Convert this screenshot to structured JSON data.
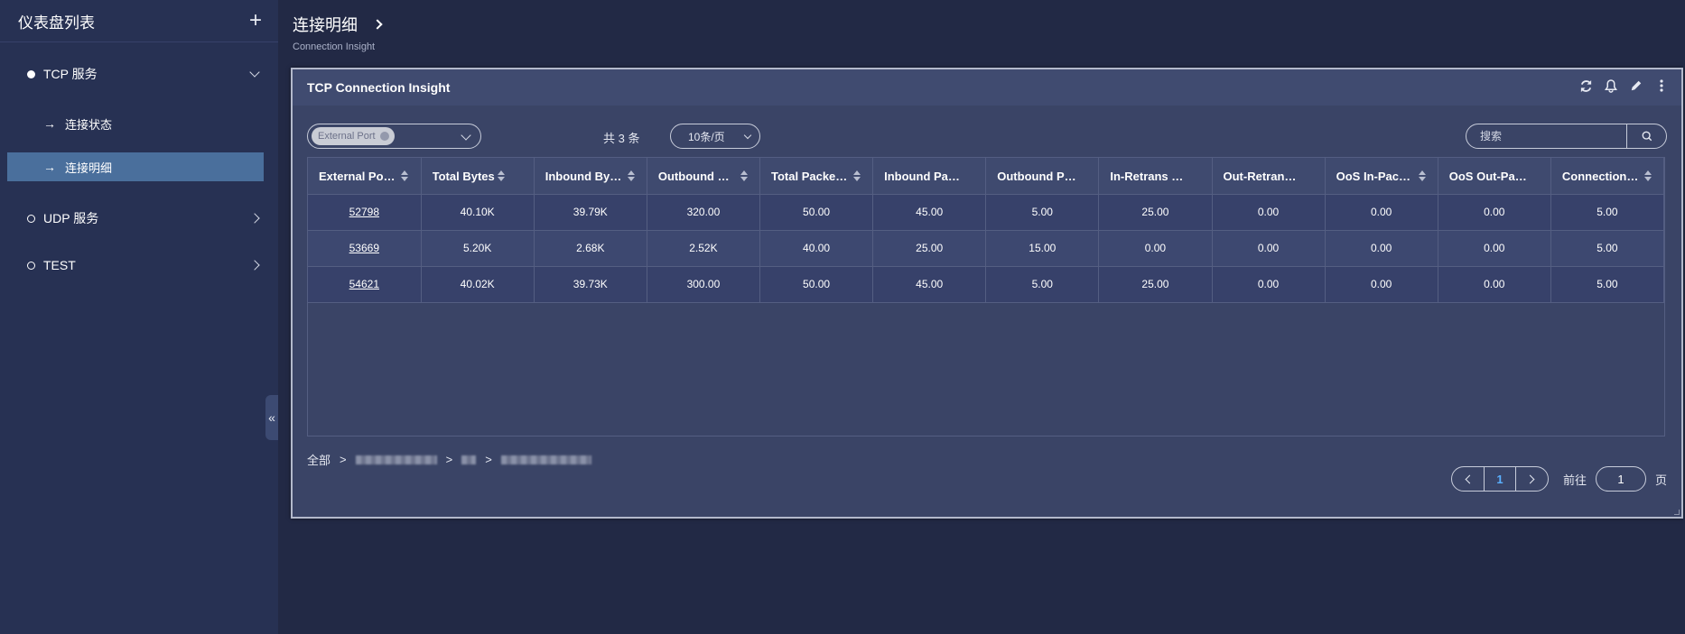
{
  "sidebar": {
    "title": "仪表盘列表",
    "add_icon": "plus-icon",
    "groups": [
      {
        "label": "TCP 服务",
        "expanded": true,
        "items": [
          {
            "label": "连接状态",
            "active": false
          },
          {
            "label": "连接明细",
            "active": true
          }
        ]
      },
      {
        "label": "UDP 服务",
        "expanded": false
      },
      {
        "label": "TEST",
        "expanded": false
      }
    ]
  },
  "page": {
    "title": "连接明细",
    "subtitle": "Connection Insight"
  },
  "panel": {
    "title": "TCP Connection Insight",
    "tools": [
      "refresh-icon",
      "bell-icon",
      "edit-icon",
      "more-icon"
    ],
    "filter_tag": "External Port",
    "total_text": "共 3 条",
    "page_size": "10条/页",
    "search_placeholder": "搜索",
    "columns": [
      "External Port ...",
      "Total Bytes",
      "Inbound Bytes...",
      "Outbound Byt...",
      "Total Packets ...",
      "Inbound Pack...",
      "Outbound Pac...",
      "In-Retrans Pa...",
      "Out-Retrans P...",
      "OoS In-Packet...",
      "OoS Out-Pack...",
      "Connections ..."
    ],
    "rows": [
      [
        "52798",
        "40.10K",
        "39.79K",
        "320.00",
        "50.00",
        "45.00",
        "5.00",
        "25.00",
        "0.00",
        "0.00",
        "0.00",
        "5.00"
      ],
      [
        "53669",
        "5.20K",
        "2.68K",
        "2.52K",
        "40.00",
        "25.00",
        "15.00",
        "0.00",
        "0.00",
        "0.00",
        "0.00",
        "5.00"
      ],
      [
        "54621",
        "40.02K",
        "39.73K",
        "300.00",
        "50.00",
        "45.00",
        "5.00",
        "25.00",
        "0.00",
        "0.00",
        "0.00",
        "5.00"
      ]
    ],
    "breadcrumb": {
      "root": "全部",
      "sep": ">"
    },
    "pagination": {
      "current": "1",
      "goto_label": "前往",
      "goto_value": "1",
      "unit": "页"
    }
  },
  "colors": {
    "accent": "#5ab0ff",
    "active_item": "#4a6f9c",
    "background": "#222945"
  }
}
